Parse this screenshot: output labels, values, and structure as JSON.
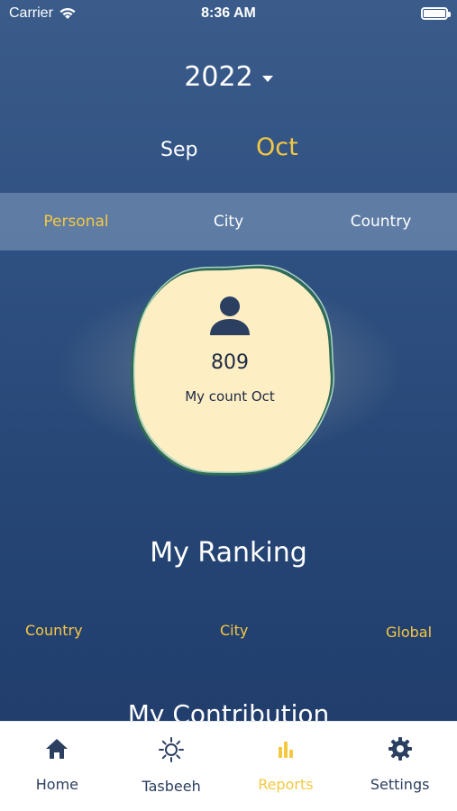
{
  "status_bar": {
    "carrier": "Carrier",
    "time": "8:36 AM"
  },
  "year_selector": {
    "value": "2022"
  },
  "months": {
    "previous": "Sep",
    "current": "Oct"
  },
  "scope_tabs": [
    {
      "label": "Personal",
      "active": true
    },
    {
      "label": "City",
      "active": false
    },
    {
      "label": "Country",
      "active": false
    }
  ],
  "count_card": {
    "value": "809",
    "label": "My count Oct"
  },
  "ranking": {
    "title": "My Ranking",
    "items": [
      "Country",
      "City",
      "Global"
    ]
  },
  "contribution": {
    "title": "My Contribution"
  },
  "tab_bar": [
    {
      "label": "Home",
      "icon": "home-icon",
      "active": false
    },
    {
      "label": "Tasbeeh",
      "icon": "sun-icon",
      "active": false
    },
    {
      "label": "Reports",
      "icon": "bar-chart-icon",
      "active": true
    },
    {
      "label": "Settings",
      "icon": "gear-icon",
      "active": false
    }
  ],
  "colors": {
    "accent": "#f5c842",
    "background_top": "#3b5c8a",
    "background_bottom": "#1f3b69",
    "card_fill": "#fdeec3",
    "card_border": "#2f6b55"
  }
}
